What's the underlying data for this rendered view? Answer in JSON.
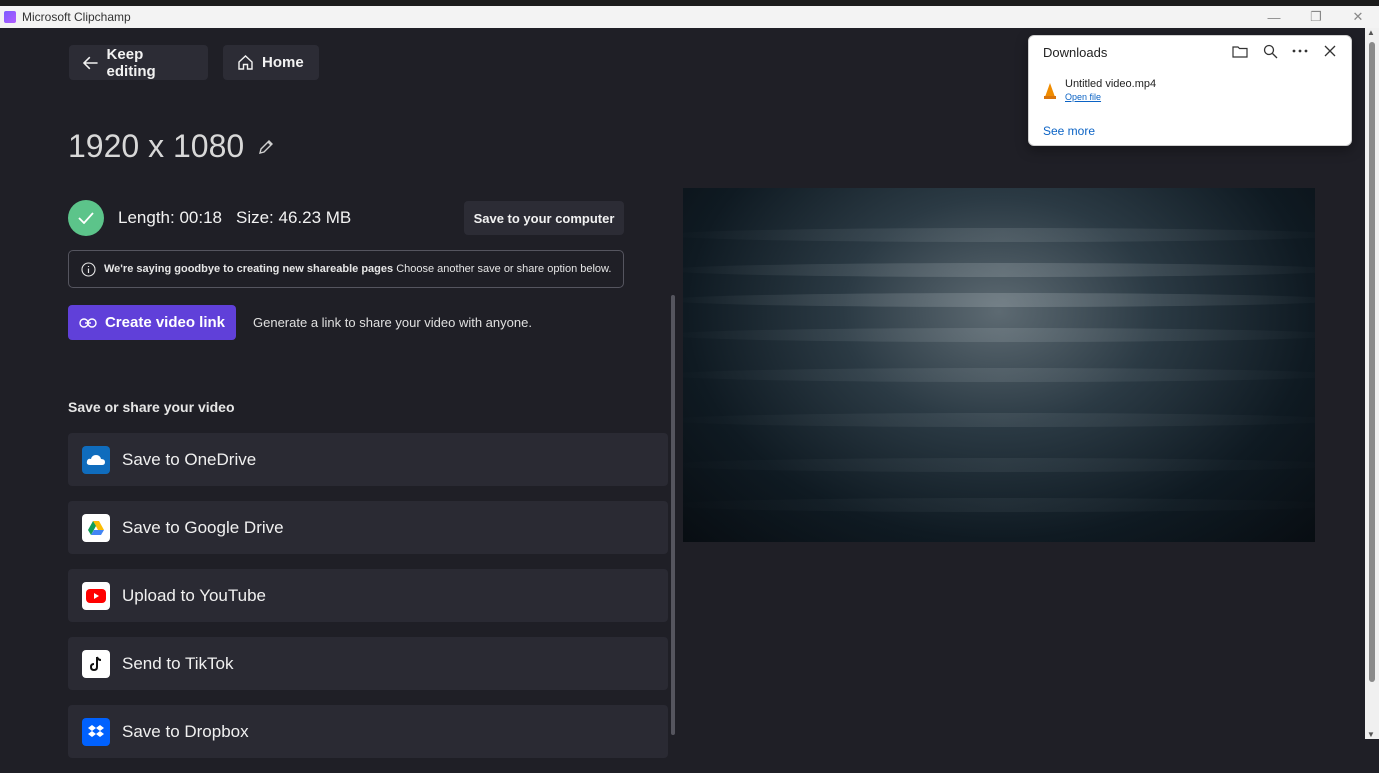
{
  "window": {
    "title": "Microsoft Clipchamp",
    "minimize_glyph": "—",
    "restore_glyph": "❐",
    "close_glyph": "✕"
  },
  "nav": {
    "keep_editing": "Keep editing",
    "home": "Home"
  },
  "export": {
    "resolution": "1920 x 1080",
    "length": "Length: 00:18",
    "size": "Size: 46.23 MB",
    "save_computer": "Save to your computer",
    "notice_bold": "We're saying goodbye to creating new shareable pages",
    "notice_rest": "Choose another save or share option below.",
    "create_link": "Create video link",
    "create_link_desc": "Generate a link to share your video with anyone."
  },
  "share": {
    "title": "Save or share your video",
    "items": [
      {
        "label": "Save to OneDrive",
        "icon": "onedrive-icon",
        "color": "#0f6cbd"
      },
      {
        "label": "Save to Google Drive",
        "icon": "google-drive-icon",
        "color": "#ffffff"
      },
      {
        "label": "Upload to YouTube",
        "icon": "youtube-icon",
        "color": "#ffffff"
      },
      {
        "label": "Send to TikTok",
        "icon": "tiktok-icon",
        "color": "#ffffff"
      },
      {
        "label": "Save to Dropbox",
        "icon": "dropbox-icon",
        "color": "#0061fe"
      }
    ]
  },
  "downloads": {
    "title": "Downloads",
    "file_name": "Untitled video.mp4",
    "open_file": "Open file",
    "see_more": "See more"
  },
  "colors": {
    "accent": "#6040d9",
    "success": "#5cc48a",
    "background": "#1f1f26"
  }
}
